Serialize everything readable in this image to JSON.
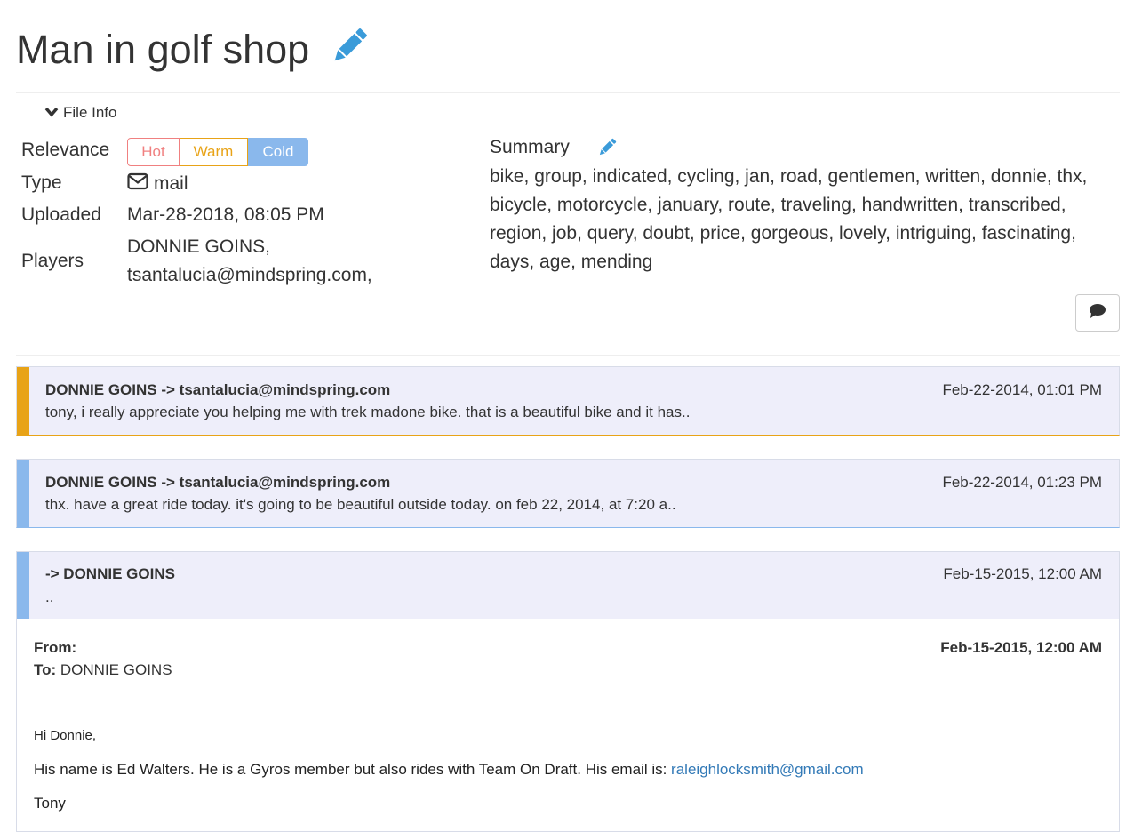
{
  "page": {
    "title": "Man in golf shop",
    "accent_color": "#3a9bd9"
  },
  "file_info": {
    "toggle_label": "File Info",
    "relevance_label": "Relevance",
    "relevance_options": [
      "Hot",
      "Warm",
      "Cold"
    ],
    "relevance_selected": "Cold",
    "type_label": "Type",
    "type_icon": "envelope-icon",
    "type_value": "mail",
    "uploaded_label": "Uploaded",
    "uploaded_value": "Mar-28-2018, 08:05 PM",
    "players_label": "Players",
    "players_line1": "DONNIE GOINS,",
    "players_line2": "tsantalucia@mindspring.com,",
    "summary_label": "Summary",
    "summary_text": "bike, group, indicated, cycling, jan, road, gentlemen, written, donnie, thx, bicycle, motorcycle, january, route, traveling, handwritten, transcribed, region, job, query, doubt, price, gorgeous, lovely, intriguing, fascinating, days, age, mending"
  },
  "messages": [
    {
      "header": "DONNIE GOINS -> tsantalucia@mindspring.com",
      "date": "Feb-22-2014, 01:01 PM",
      "snippet": "tony, i really appreciate you helping me with trek madone bike. that is a beautiful bike and it has..",
      "bar_color": "#e8a317"
    },
    {
      "header": "DONNIE GOINS -> tsantalucia@mindspring.com",
      "date": "Feb-22-2014, 01:23 PM",
      "snippet": "thx. have a great ride today. it's going to be beautiful outside today. on feb 22, 2014, at 7:20 a..",
      "bar_color": "#8ab8ec"
    },
    {
      "header": "-> DONNIE GOINS",
      "date": "Feb-15-2015, 12:00 AM",
      "snippet": "..",
      "bar_color": "#8ab8ec"
    }
  ],
  "email": {
    "from_label": "From:",
    "from_value": "",
    "to_label": "To:",
    "to_value": "DONNIE GOINS",
    "date": "Feb-15-2015, 12:00 AM",
    "greeting": "Hi Donnie,",
    "body_text": "His name is Ed Walters. He is a Gyros member but also rides with Team On Draft. His email is: ",
    "body_link": "raleighlocksmith@gmail.com",
    "signature": "Tony"
  }
}
